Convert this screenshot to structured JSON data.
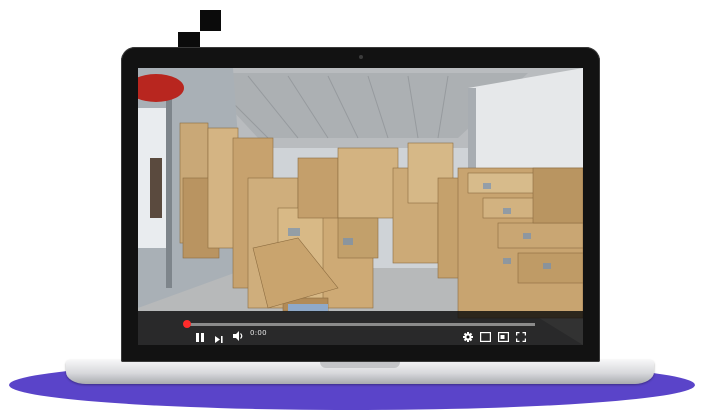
{
  "player": {
    "time": "0:00",
    "progress_fraction": 0.01,
    "icons": {
      "play_pause": "pause-icon",
      "next": "next-icon",
      "volume": "volume-icon",
      "settings": "gear-icon",
      "miniplayer": "miniplayer-icon",
      "theater": "theater-mode-icon",
      "fullscreen": "fullscreen-icon"
    }
  },
  "colors": {
    "platform": "#5a44c9",
    "progress": "#ff1a1a",
    "bezel": "#121212"
  }
}
